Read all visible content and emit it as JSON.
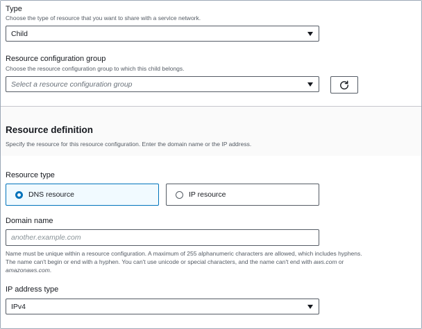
{
  "type_field": {
    "label": "Type",
    "description": "Choose the type of resource that you want to share with a service network.",
    "selected": "Child"
  },
  "group_field": {
    "label": "Resource configuration group",
    "description": "Choose the resource configuration group to which this child belongs.",
    "placeholder": "Select a resource configuration group",
    "refresh_icon": "refresh-icon"
  },
  "definition": {
    "heading": "Resource definition",
    "description": "Specify the resource for this resource configuration. Enter the domain name or the IP address."
  },
  "resource_type": {
    "label": "Resource type",
    "options": [
      {
        "label": "DNS resource",
        "selected": true
      },
      {
        "label": "IP resource",
        "selected": false
      }
    ]
  },
  "domain_name": {
    "label": "Domain name",
    "placeholder": "another.example.com",
    "help_line1": "Name must be unique within a resource configuration. A maximum of 255 alphanumeric characters are allowed, which includes hyphens.",
    "help_line2_start": "The name can't begin or end with a hyphen. You can't use unicode or special characters, and the name can't end with ",
    "help_aws": "aws.com",
    "help_or": " or",
    "help_amazonaws": "amazonaws.com",
    "help_end": "."
  },
  "ip_type": {
    "label": "IP address type",
    "selected": "IPv4"
  },
  "colors": {
    "accent": "#0073bb",
    "border": "#545b64",
    "selected_tile_bg": "#f1faff"
  }
}
